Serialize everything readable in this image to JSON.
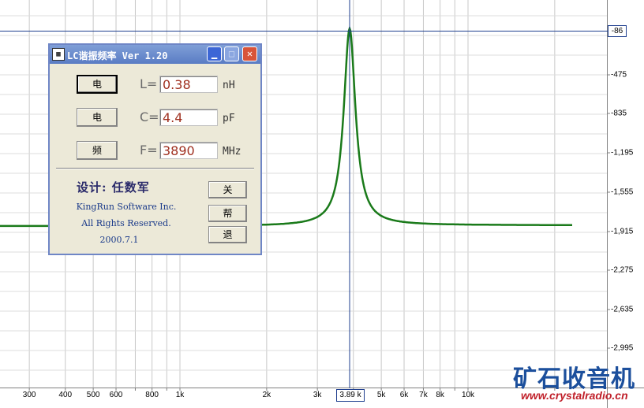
{
  "graph": {
    "y_ticks": [
      "-475",
      "-835",
      "-1,195",
      "-1,555",
      "-1,915",
      "-2,275",
      "-2,635",
      "-2,995"
    ],
    "x_ticks": [
      "300",
      "400",
      "500",
      "600",
      "800",
      "1k",
      "2k",
      "3k",
      "5k",
      "6k",
      "7k",
      "8k",
      "10k"
    ],
    "cursor_y_label": "-86",
    "cursor_x_label": "3.89 k",
    "line_color": "#1a7a1a",
    "cursor_color": "#1f3f8f"
  },
  "dialog": {
    "title": "LC谐振频率 Ver 1.20",
    "app_icon": "app-icon",
    "rows": [
      {
        "button": "电",
        "label": "L=",
        "value": "0.38",
        "unit": "nH"
      },
      {
        "button": "电",
        "label": "C=",
        "value": "4.4",
        "unit": "pF"
      },
      {
        "button": "频",
        "label": "F=",
        "value": "3890",
        "unit": "MHz"
      }
    ],
    "credit": "设计: 任数军",
    "company": "KingRun Software Inc.",
    "rights": "All Rights Reserved.",
    "date": "2000.7.1",
    "close_button": "关",
    "help_button": "帮",
    "exit_button": "退"
  },
  "watermark": {
    "logo_text": "矿石收音机",
    "url": "www.crystalradio.cn"
  }
}
